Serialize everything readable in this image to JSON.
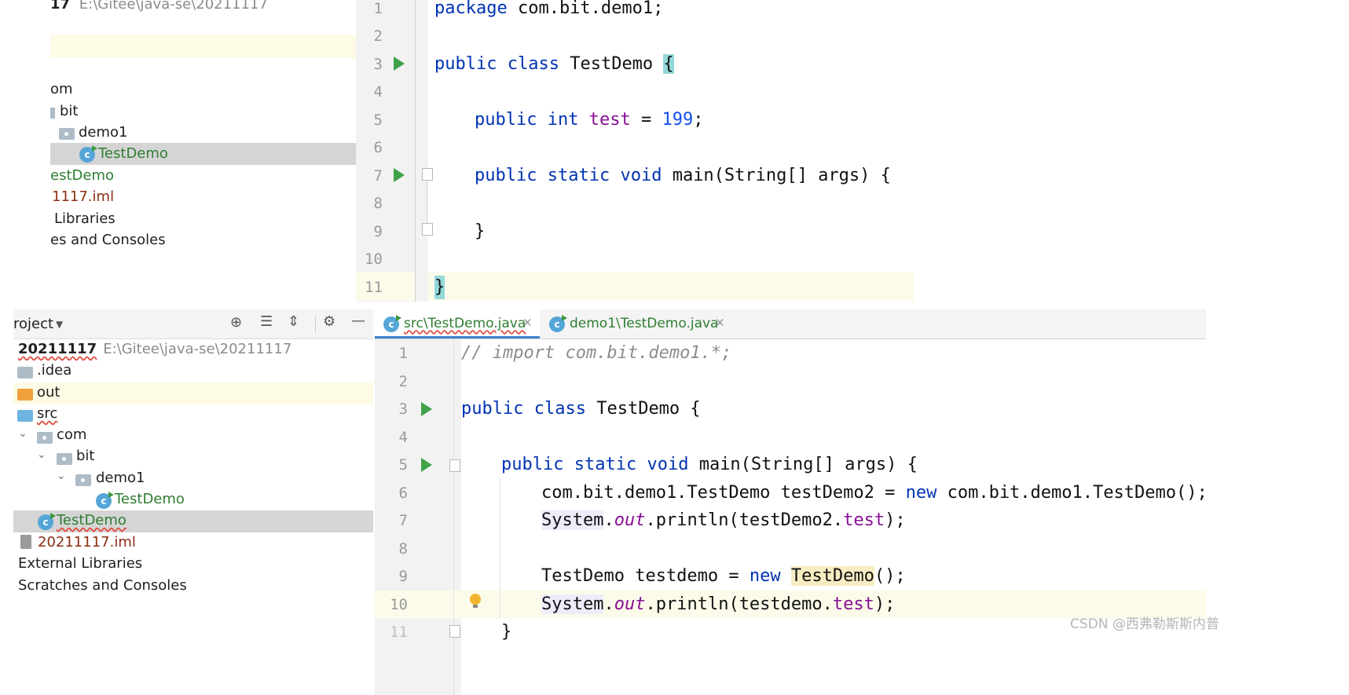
{
  "top": {
    "tree": {
      "root_name": "17",
      "root_path": "E:\\Gitee\\java-se\\20211117",
      "com": "om",
      "bit": "bit",
      "demo1": "demo1",
      "testdemo_selected": "TestDemo",
      "testdemo_root": "estDemo",
      "iml": "1117.iml",
      "ext_libs": "Libraries",
      "scratches": "es and Consoles"
    },
    "editor": {
      "line_numbers": [
        "1",
        "2",
        "3",
        "4",
        "5",
        "6",
        "7",
        "8",
        "9",
        "10",
        "11"
      ],
      "l1_pkg": "package",
      "l1_rest": " com.bit.demo1;",
      "l3_public": "public",
      "l3_class": "class",
      "l3_name": " TestDemo ",
      "l3_brace": "{",
      "l5_public": "public",
      "l5_int": "int",
      "l5_field": "test",
      "l5_eq": " = ",
      "l5_num": "199",
      "l5_semi": ";",
      "l7_public": "public",
      "l7_static": "static",
      "l7_void": "void",
      "l7_rest": " main(String[] args) {",
      "l9_brace": "}",
      "l11_brace": "}"
    }
  },
  "bottom": {
    "panel": {
      "title": "roject",
      "tree": {
        "root_name": "20211117",
        "root_path": "E:\\Gitee\\java-se\\20211117",
        "idea": ".idea",
        "out": "out",
        "src": "src",
        "com": "com",
        "bit": "bit",
        "demo1": "demo1",
        "testdemo_pkg": "TestDemo",
        "testdemo_src": "TestDemo",
        "iml": "20211117.iml",
        "ext_libs": "External Libraries",
        "scratches": "Scratches and Consoles"
      }
    },
    "tabs": [
      {
        "label": "src\\TestDemo.java",
        "active": true
      },
      {
        "label": "demo1\\TestDemo.java",
        "active": false
      }
    ],
    "editor": {
      "line_numbers": [
        "1",
        "2",
        "3",
        "4",
        "5",
        "6",
        "7",
        "8",
        "9",
        "10",
        "11"
      ],
      "l1_comment": "// import com.bit.demo1.*;",
      "l3_public": "public",
      "l3_class": "class",
      "l3_rest": " TestDemo {",
      "l5_public": "public",
      "l5_static": "static",
      "l5_void": "void",
      "l5_rest": " main(String[] args) {",
      "l6_a": "com.bit.demo1.TestDemo testDemo2 = ",
      "l6_new": "new",
      "l6_b": " com.bit.demo1.TestDemo();",
      "l7_sys": "System",
      "l7_dot": ".",
      "l7_out": "out",
      "l7_call": ".println(testDemo2.",
      "l7_field": "test",
      "l7_end": ");",
      "l9_a": "TestDemo testdemo = ",
      "l9_new": "new",
      "l9_sp": " ",
      "l9_cls": "TestDemo",
      "l9_end": "();",
      "l10_sys": "System",
      "l10_dot": ".",
      "l10_out": "out",
      "l10_call": ".println(testdemo.",
      "l10_field": "test",
      "l10_end": ");",
      "l11_brace": "}"
    },
    "watermark": "CSDN @西弗勒斯斯内普"
  }
}
